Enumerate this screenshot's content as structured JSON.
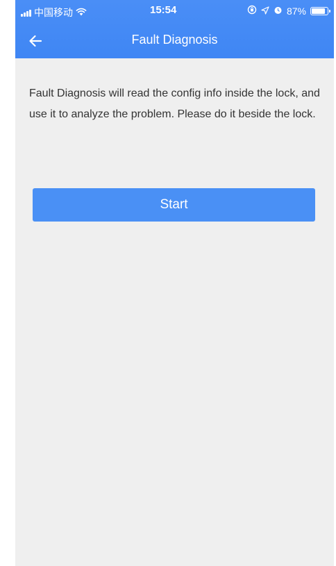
{
  "status_bar": {
    "carrier": "中国移动",
    "time": "15:54",
    "battery_text": "87%",
    "battery_level": 0.87,
    "icons": [
      "signal-icon",
      "wifi-icon",
      "lock-rotation-icon",
      "location-icon",
      "alarm-icon",
      "battery-icon"
    ]
  },
  "header": {
    "title": "Fault Diagnosis",
    "back_icon": "back-arrow-icon"
  },
  "content": {
    "description": "Fault Diagnosis will read the config info inside the lock, and use it to analyze the problem. Please do it beside the lock."
  },
  "actions": {
    "start_label": "Start"
  },
  "colors": {
    "header_bg": "#3f86f4",
    "button_bg": "#4a90f5",
    "page_bg": "#efefef",
    "text": "#333333"
  }
}
